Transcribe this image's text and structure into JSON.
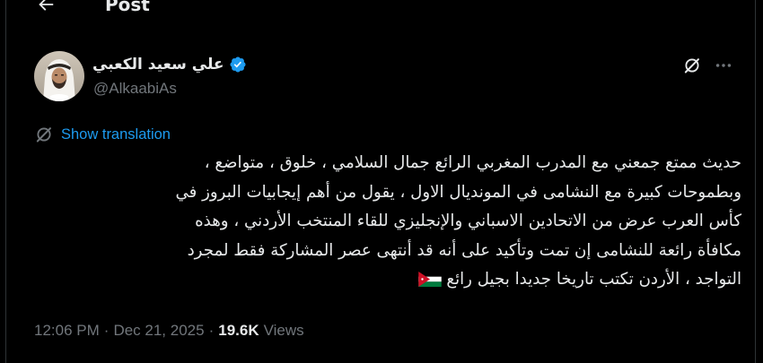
{
  "header": {
    "title": "Post",
    "back_icon": "arrow-left-icon"
  },
  "author": {
    "display_name": "علي سعيد الكعبي",
    "handle": "@AlkaabiAs",
    "verified": true,
    "verified_color": "#1d9bf0",
    "avatar_icon": "profile-photo"
  },
  "actions": {
    "grok_icon": "grok-icon",
    "more_icon": "more-horizontal-icon"
  },
  "translation": {
    "label": "Show translation",
    "icon": "globe-translate-icon",
    "color": "#1d9bf0"
  },
  "post": {
    "lines": [
      "حديث ممتع جمعني مع المدرب المغربي الرائع جمال السلامي ، خلوق ، متواضع ،",
      "وبطموحات كبيرة مع النشامى في المونديال الاول ، يقول من أهم إيجابيات البروز في",
      "كأس العرب عرض من الاتحادين الاسباني والإنجليزي للقاء المنتخب الأردني ، وهذه",
      "مكافأة رائعة للنشامى إن تمت وتأكيد على أنه قد أنتهى عصر المشاركة فقط لمجرد",
      "التواجد ، الأردن تكتب تاريخا جديدا بجيل رائع"
    ],
    "flag_emoji": "jordan-flag"
  },
  "meta": {
    "time": "12:06 PM",
    "separator": "·",
    "date": "Dec 21, 2025",
    "views_count": "19.6K",
    "views_label": "Views"
  },
  "colors": {
    "background": "#000000",
    "text_primary": "#e7e9ea",
    "text_secondary": "#71767b",
    "accent": "#1d9bf0",
    "border": "#2f3336"
  }
}
